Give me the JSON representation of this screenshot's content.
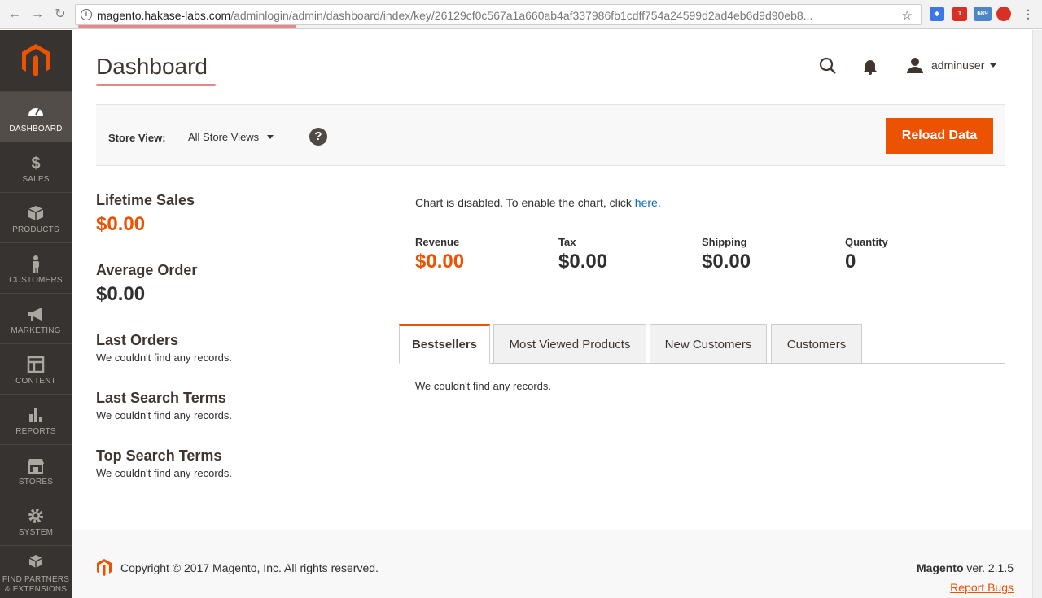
{
  "browser": {
    "url_host": "magento.hakase-labs.com",
    "url_path": "/adminlogin/admin/dashboard/index/key/26129cf0c567a1a660ab4af337986fb1cdff754a24599d2ad4eb6d9d90eb8...",
    "badge_count": "1",
    "badge_689": "689"
  },
  "sidebar": {
    "items": [
      {
        "label": "Dashboard",
        "icon": "dashboard-icon"
      },
      {
        "label": "Sales",
        "icon": "dollar-icon"
      },
      {
        "label": "Products",
        "icon": "box-icon"
      },
      {
        "label": "Customers",
        "icon": "person-icon"
      },
      {
        "label": "Marketing",
        "icon": "megaphone-icon"
      },
      {
        "label": "Content",
        "icon": "layout-icon"
      },
      {
        "label": "Reports",
        "icon": "bar-chart-icon"
      },
      {
        "label": "Stores",
        "icon": "storefront-icon"
      },
      {
        "label": "System",
        "icon": "gear-icon"
      },
      {
        "label": "Find Partners",
        "label2": "& Extensions",
        "icon": "cubes-icon"
      }
    ]
  },
  "header": {
    "title": "Dashboard",
    "username": "adminuser"
  },
  "store_bar": {
    "label": "Store View:",
    "selected": "All Store Views",
    "reload_label": "Reload Data"
  },
  "left": {
    "lifetime_label": "Lifetime Sales",
    "lifetime_value": "$0.00",
    "avg_label": "Average Order",
    "avg_value": "$0.00",
    "last_orders_label": "Last Orders",
    "last_orders_msg": "We couldn't find any records.",
    "last_search_label": "Last Search Terms",
    "last_search_msg": "We couldn't find any records.",
    "top_search_label": "Top Search Terms",
    "top_search_msg": "We couldn't find any records."
  },
  "chart": {
    "msg": "Chart is disabled. To enable the chart, click ",
    "link": "here",
    "period": "."
  },
  "totals": [
    {
      "label": "Revenue",
      "value": "$0.00"
    },
    {
      "label": "Tax",
      "value": "$0.00"
    },
    {
      "label": "Shipping",
      "value": "$0.00"
    },
    {
      "label": "Quantity",
      "value": "0"
    }
  ],
  "tabs": [
    {
      "label": "Bestsellers"
    },
    {
      "label": "Most Viewed Products"
    },
    {
      "label": "New Customers"
    },
    {
      "label": "Customers"
    }
  ],
  "tab_content": "We couldn't find any records.",
  "footer": {
    "copyright": "Copyright © 2017 Magento, Inc. All rights reserved.",
    "product": "Magento",
    "version": " ver. 2.1.5",
    "report": "Report Bugs"
  },
  "colors": {
    "accent": "#eb5202",
    "sidebar": "#373330",
    "link": "#006bb4"
  }
}
